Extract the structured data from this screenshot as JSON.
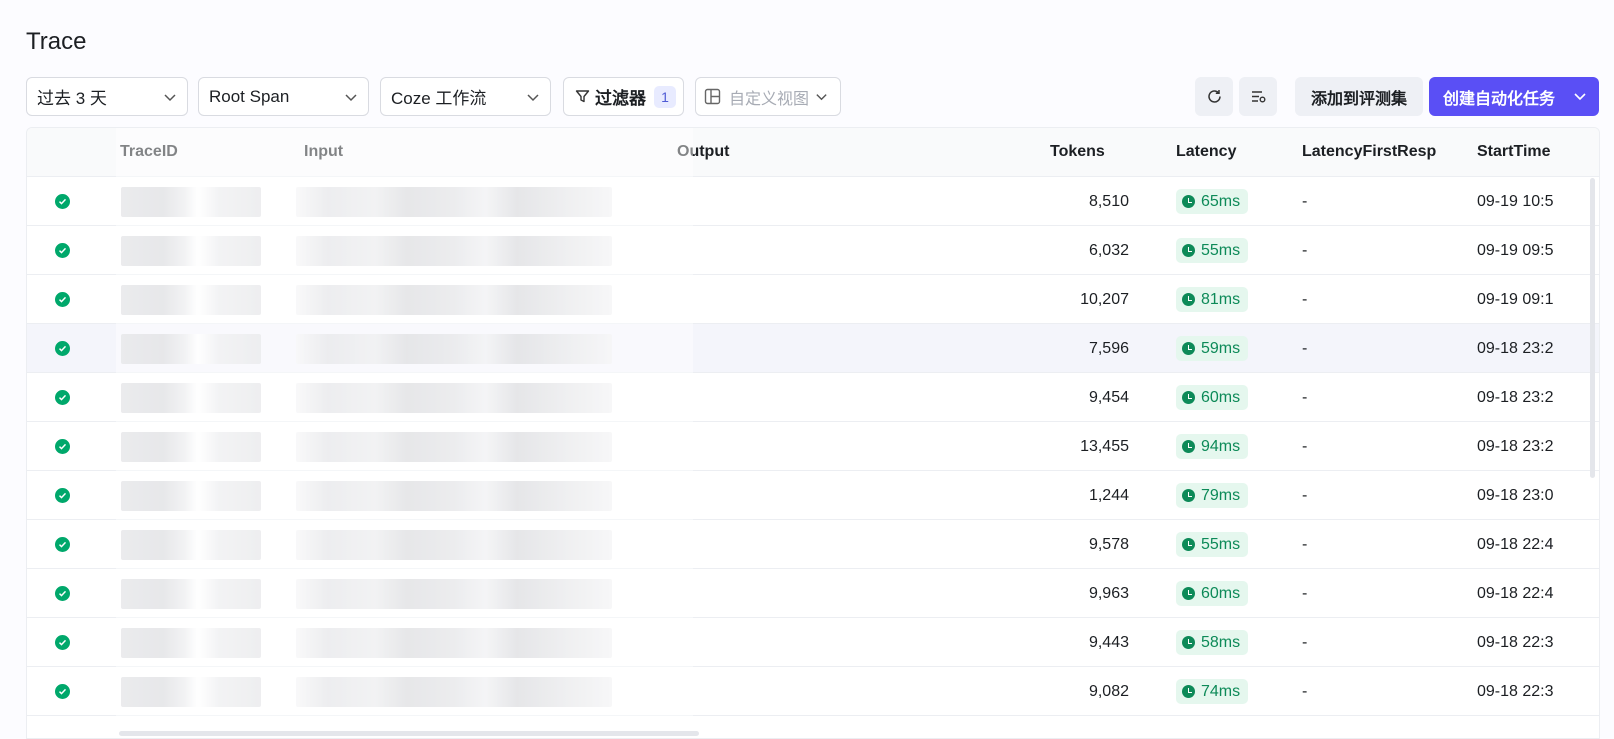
{
  "page": {
    "title": "Trace"
  },
  "toolbar": {
    "time_range": "过去 3 天",
    "span_type": "Root Span",
    "source": "Coze 工作流",
    "filter_label": "过滤器",
    "filter_count": "1",
    "custom_view_placeholder": "自定义视图",
    "add_to_evalset": "添加到评测集",
    "create_task": "创建自动化任务"
  },
  "table": {
    "columns": {
      "trace_id": "TraceID",
      "input": "Input",
      "output": "Output",
      "tokens": "Tokens",
      "latency": "Latency",
      "latency_first": "LatencyFirstResp",
      "start_time": "StartTime"
    },
    "rows": [
      {
        "tokens": "8,510",
        "latency": "65ms",
        "latency_first": "-",
        "start_time": "09-19 10:5"
      },
      {
        "tokens": "6,032",
        "latency": "55ms",
        "latency_first": "-",
        "start_time": "09-19 09:5"
      },
      {
        "tokens": "10,207",
        "latency": "81ms",
        "latency_first": "-",
        "start_time": "09-19 09:1"
      },
      {
        "tokens": "7,596",
        "latency": "59ms",
        "latency_first": "-",
        "start_time": "09-18 23:2"
      },
      {
        "tokens": "9,454",
        "latency": "60ms",
        "latency_first": "-",
        "start_time": "09-18 23:2"
      },
      {
        "tokens": "13,455",
        "latency": "94ms",
        "latency_first": "-",
        "start_time": "09-18 23:2"
      },
      {
        "tokens": "1,244",
        "latency": "79ms",
        "latency_first": "-",
        "start_time": "09-18 23:0"
      },
      {
        "tokens": "9,578",
        "latency": "55ms",
        "latency_first": "-",
        "start_time": "09-18 22:4"
      },
      {
        "tokens": "9,963",
        "latency": "60ms",
        "latency_first": "-",
        "start_time": "09-18 22:4"
      },
      {
        "tokens": "9,443",
        "latency": "58ms",
        "latency_first": "-",
        "start_time": "09-18 22:3"
      },
      {
        "tokens": "9,082",
        "latency": "74ms",
        "latency_first": "-",
        "start_time": "09-18 22:3"
      }
    ]
  },
  "colors": {
    "accent": "#5a4ff5",
    "success": "#00a86b",
    "latency_text": "#0d8a58"
  }
}
